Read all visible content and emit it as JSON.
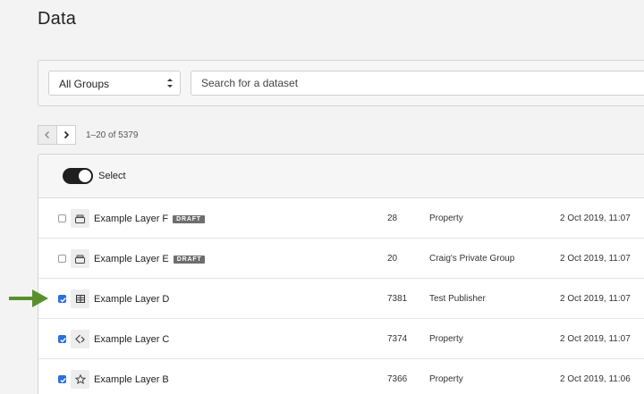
{
  "page": {
    "title": "Data"
  },
  "filters": {
    "group_select_value": "All Groups",
    "search_placeholder": "Search for a dataset"
  },
  "pager": {
    "range_text": "1–20 of 5379"
  },
  "list": {
    "select_toggle_label": "Select",
    "select_toggle_on": true,
    "rows": [
      {
        "name": "Example Layer F",
        "draft": "DRAFT",
        "icon": "layer-stack-icon",
        "count": "28",
        "group": "Property",
        "date": "2 Oct 2019, 11:07",
        "checked": false
      },
      {
        "name": "Example Layer E",
        "draft": "DRAFT",
        "icon": "layer-stack-icon",
        "count": "20",
        "group": "Craig's Private Group",
        "date": "2 Oct 2019, 11:07",
        "checked": false
      },
      {
        "name": "Example Layer D",
        "draft": "",
        "icon": "table-icon",
        "count": "7381",
        "group": "Test Publisher",
        "date": "2 Oct 2019, 11:07",
        "checked": true
      },
      {
        "name": "Example Layer C",
        "draft": "",
        "icon": "line-vector-icon",
        "count": "7374",
        "group": "Property",
        "date": "2 Oct 2019, 11:07",
        "checked": true
      },
      {
        "name": "Example Layer B",
        "draft": "",
        "icon": "polygon-icon",
        "count": "7366",
        "group": "Property",
        "date": "2 Oct 2019, 11:06",
        "checked": true
      }
    ]
  },
  "colors": {
    "checkbox_checked": "#2b6fe0",
    "pointer_arrow": "#5a8f2e",
    "draft_badge": "#6e6e6e"
  }
}
